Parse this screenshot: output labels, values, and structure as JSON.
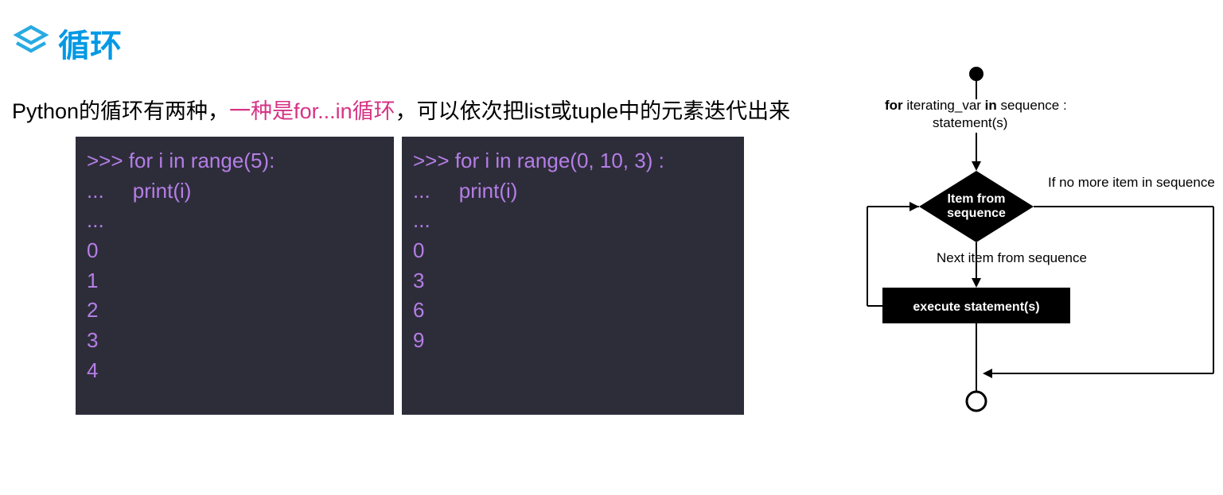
{
  "header": {
    "title": "循环"
  },
  "intro": {
    "part1": "Python的循环有两种，",
    "highlight": "一种是for...in循环",
    "part2": "，可以依次把list或tuple中的元素迭代出来"
  },
  "code": {
    "block1": ">>> for i in range(5):\n...     print(i)\n...\n0\n1\n2\n3\n4",
    "block2": ">>> for i in range(0, 10, 3) :\n...     print(i)\n...\n0\n3\n6\n9"
  },
  "diagram": {
    "for_stmt": "for iterating_var in sequence :",
    "for_body": "statement(s)",
    "diamond": "Item from\nsequence",
    "no_more": "If no more item in sequence",
    "next_item": "Next item from sequence",
    "execute": "execute statement(s)"
  }
}
